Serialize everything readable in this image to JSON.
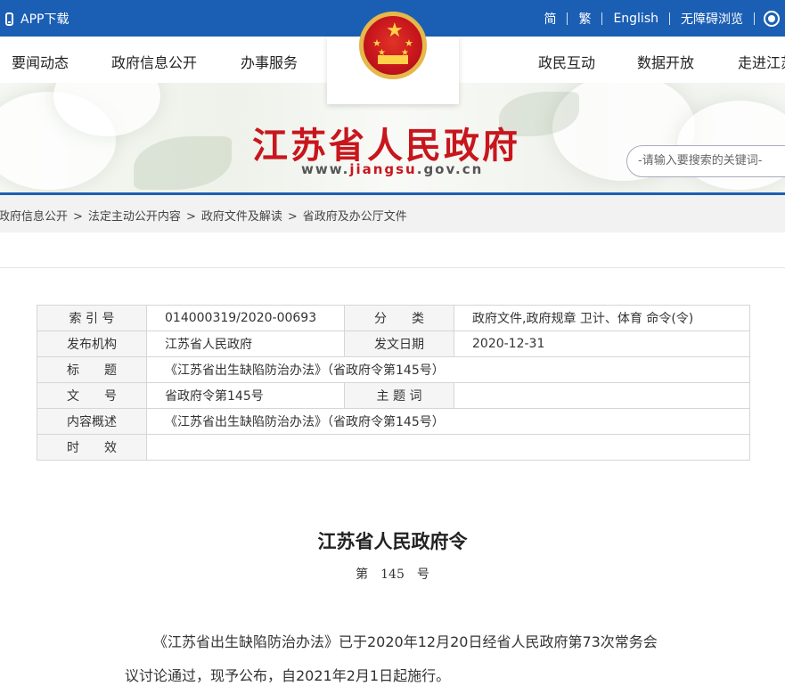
{
  "topbar": {
    "app_download": "APP下载",
    "links": [
      "简",
      "繁",
      "English",
      "无障碍浏览"
    ],
    "globe_icon": "globe-icon"
  },
  "nav": {
    "items_left": [
      "要闻动态",
      "政府信息公开",
      "办事服务"
    ],
    "items_right": [
      "政民互动",
      "数据开放",
      "走进江苏"
    ]
  },
  "banner": {
    "title": "江苏省人民政府",
    "url_prefix": "www.",
    "url_brand": "jiangsu",
    "url_suffix": ".gov.cn",
    "search_placeholder": "-请输入要搜索的关键词-"
  },
  "breadcrumb": [
    "政府信息公开",
    "法定主动公开内容",
    "政府文件及解读",
    "省政府及办公厅文件"
  ],
  "meta": {
    "index_label": "索 引 号",
    "index_value": "014000319/2020-00693",
    "category_label": "分　　类",
    "category_value": "政府文件,政府规章 卫计、体育 命令(令)",
    "publisher_label": "发布机构",
    "publisher_value": "江苏省人民政府",
    "date_label": "发文日期",
    "date_value": "2020-12-31",
    "title_label": "标　　题",
    "title_value": "《江苏省出生缺陷防治办法》（省政府令第145号）",
    "doc_no_label": "文　　号",
    "doc_no_value": "省政府令第145号",
    "keywords_label": "主 题 词",
    "keywords_value": "",
    "summary_label": "内容概述",
    "summary_value": "《江苏省出生缺陷防治办法》（省政府令第145号）",
    "validity_label": "时　　效",
    "validity_value": ""
  },
  "document": {
    "title": "江苏省人民政府令",
    "number": "第　145　号",
    "paragraph": "《江苏省出生缺陷防治办法》已于2020年12月20日经省人民政府第73次常务会议讨论通过，现予公布，自2021年2月1日起施行。"
  },
  "colors": {
    "brand_blue": "#1b5fb4",
    "brand_red": "#c8161d",
    "emblem_gold": "#e5b84b"
  }
}
